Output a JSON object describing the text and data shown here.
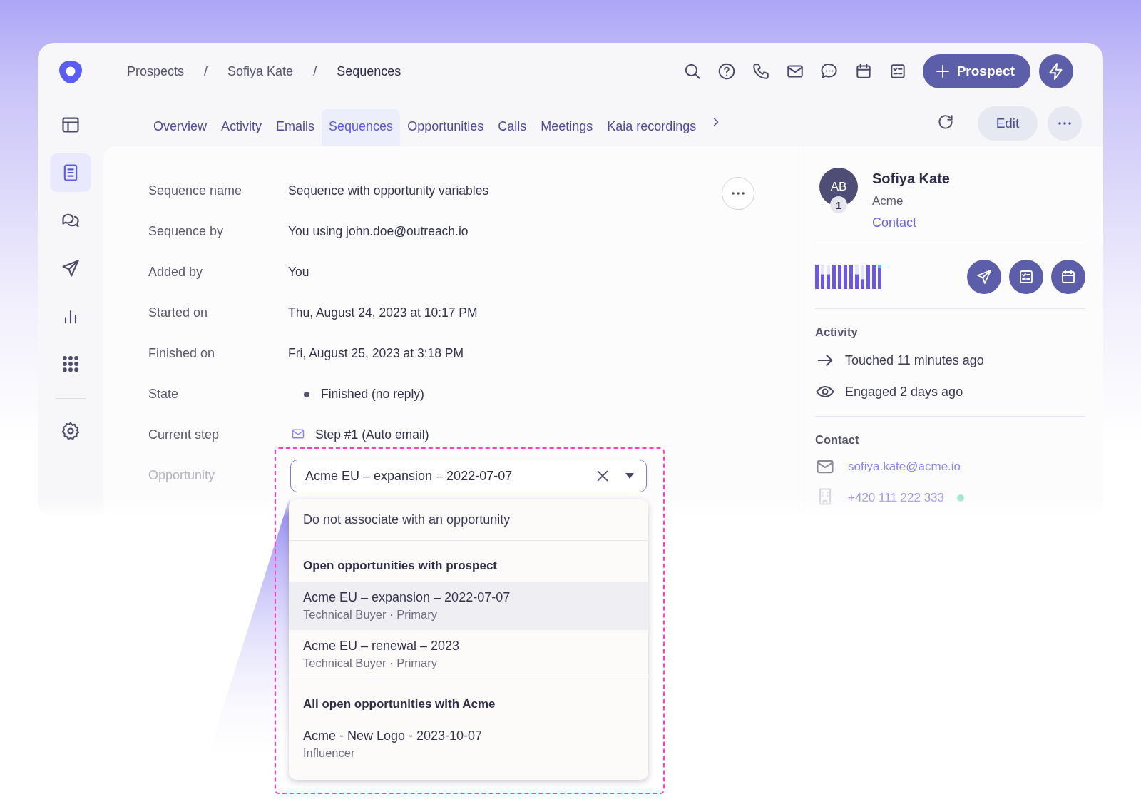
{
  "breadcrumbs": [
    "Prospects",
    "Sofiya Kate",
    "Sequences"
  ],
  "breadcrumb_separator": "/",
  "prospect_button": "Prospect",
  "sidebar": [
    {
      "kind": "layout",
      "selected": false
    },
    {
      "kind": "document",
      "selected": true
    },
    {
      "kind": "chat",
      "selected": false
    },
    {
      "kind": "send",
      "selected": false
    },
    {
      "kind": "chart",
      "selected": false
    },
    {
      "kind": "apps",
      "selected": false
    },
    {
      "kind": "settings",
      "selected": false
    }
  ],
  "tabs": [
    {
      "label": "Overview",
      "selected": false
    },
    {
      "label": "Activity",
      "selected": false
    },
    {
      "label": "Emails",
      "selected": false
    },
    {
      "label": "Sequences",
      "selected": true
    },
    {
      "label": "Opportunities",
      "selected": false
    },
    {
      "label": "Calls",
      "selected": false
    },
    {
      "label": "Meetings",
      "selected": false
    },
    {
      "label": "Kaia recordings",
      "selected": false
    }
  ],
  "edit_button": "Edit",
  "details": [
    {
      "kind": "text",
      "label": "Sequence name",
      "value": "Sequence with opportunity variables"
    },
    {
      "kind": "text",
      "label": "Sequence by",
      "value": "You using john.doe@outreach.io"
    },
    {
      "kind": "text",
      "label": "Added by",
      "value": "You"
    },
    {
      "kind": "text",
      "label": "Started on",
      "value": "Thu, August 24, 2023 at 10:17 PM"
    },
    {
      "kind": "text",
      "label": "Finished on",
      "value": "Fri, August 25, 2023 at 3:18 PM"
    },
    {
      "kind": "status",
      "label": "State",
      "value": "Finished (no reply)"
    },
    {
      "kind": "step",
      "label": "Current step",
      "value": "Step #1 (Auto email)"
    }
  ],
  "opportunity": {
    "label": "Opportunity",
    "value": "Acme EU – expansion – 2022-07-07"
  },
  "dropdown": {
    "none_option": {
      "title": "Do not associate with an opportunity",
      "selected": false
    },
    "groups": [
      {
        "heading": "Open opportunities with prospect",
        "options": [
          {
            "title": "Acme EU – expansion – 2022-07-07",
            "subtitle": "Technical Buyer · Primary",
            "selected": true
          },
          {
            "title": "Acme EU  – renewal – 2023",
            "subtitle": "Technical Buyer · Primary",
            "selected": false
          }
        ]
      },
      {
        "heading": "All open opportunities with Acme",
        "options": [
          {
            "title": "Acme - New Logo - 2023-10-07",
            "subtitle": "Influencer",
            "selected": false
          }
        ]
      }
    ]
  },
  "contact": {
    "initials": "AB",
    "badge": "1",
    "name": "Sofiya Kate",
    "company": "Acme",
    "link": "Contact"
  },
  "activity": {
    "heading": "Activity",
    "items": [
      {
        "kind": "touched",
        "text": "Touched 11 minutes ago"
      },
      {
        "kind": "engaged",
        "text": "Engaged 2 days ago"
      }
    ]
  },
  "contact_info": {
    "heading": "Contact",
    "email": "sofiya.kate@acme.io",
    "phone": "+420 111 222 333"
  }
}
